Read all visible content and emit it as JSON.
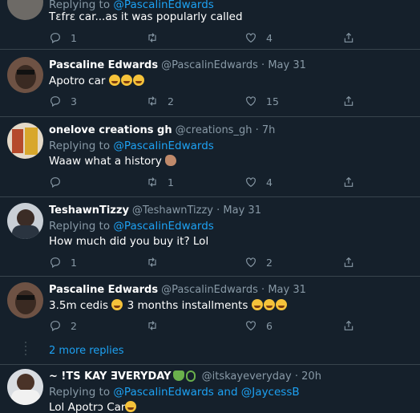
{
  "tweets": [
    {
      "body": "Tɛfrɛ car...as it was popularly called",
      "replying_label": "Replying to",
      "replying_to": "@PascalinEdwards",
      "replies": "1",
      "retweets": "",
      "likes": "4"
    },
    {
      "name": "Pascaline Edwards",
      "handle": "@PascalinEdwards",
      "sep": "·",
      "time": "May 31",
      "body": "Apotro car",
      "replies": "3",
      "retweets": "2",
      "likes": "15"
    },
    {
      "name": "onelove creations gh",
      "handle": "@creations_gh",
      "sep": "·",
      "time": "7h",
      "replying_label": "Replying to",
      "replying_to": "@PascalinEdwards",
      "body": "Waaw what a history",
      "replies": "",
      "retweets": "1",
      "likes": "4"
    },
    {
      "name": "TeshawnTizzy",
      "handle": "@TeshawnTizzy",
      "sep": "·",
      "time": "May 31",
      "replying_label": "Replying to",
      "replying_to": "@PascalinEdwards",
      "body": "How much did you buy it? Lol",
      "replies": "1",
      "retweets": "",
      "likes": "2"
    },
    {
      "name": "Pascaline Edwards",
      "handle": "@PascalinEdwards",
      "sep": "·",
      "time": "May 31",
      "body_a": "3.5m cedis",
      "body_b": "3 months installments",
      "replies": "2",
      "retweets": "",
      "likes": "6"
    },
    {
      "name": "~ !TS KAY ƎVERYDAY",
      "handle": "@itskayeveryday",
      "sep": "·",
      "time": "20h",
      "replying_label": "Replying to",
      "replying_to": "@PascalinEdwards and @JaycessB",
      "body": "Lol Apotrɔ Car"
    }
  ],
  "more_replies": "2 more replies",
  "icons": {
    "reply": "reply-icon",
    "retweet": "retweet-icon",
    "like": "heart-icon",
    "share": "share-icon"
  },
  "colors": {
    "background": "#15202b",
    "accent": "#1da1f2",
    "muted": "#8899a6",
    "divider": "#38444d"
  }
}
